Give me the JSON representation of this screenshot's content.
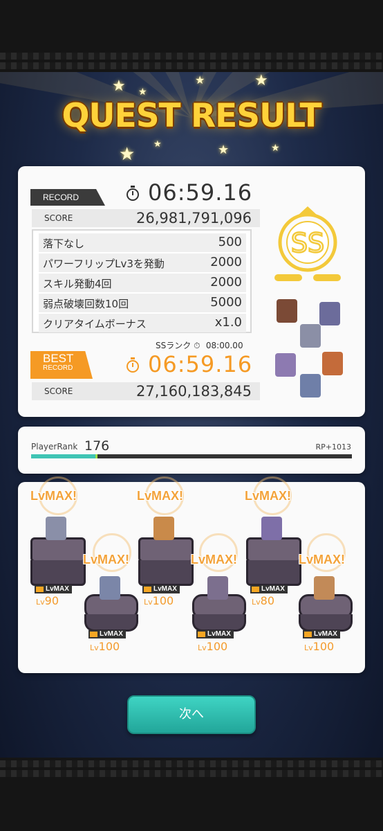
{
  "title": "QUEST RESULT",
  "record": {
    "tag": "RECORD",
    "time": "06:59.16",
    "score_label": "SCORE",
    "score": "26,981,791,096"
  },
  "bonuses": [
    {
      "name": "落下なし",
      "value": "500"
    },
    {
      "name": "パワーフリップLv3を発動",
      "value": "2000"
    },
    {
      "name": "スキル発動4回",
      "value": "2000"
    },
    {
      "name": "弱点破壊回数10回",
      "value": "5000"
    },
    {
      "name": "クリアタイムボーナス",
      "value": "x1.0"
    }
  ],
  "rank_grade": "SS",
  "ss_rank": {
    "label": "SSランク",
    "time": "08:00.00"
  },
  "best": {
    "tag_big": "BEST",
    "tag_small": "RECORD",
    "time": "06:59.16",
    "score_label": "SCORE",
    "score": "27,160,183,845"
  },
  "player": {
    "rank_label": "PlayerRank",
    "rank": "176",
    "rp": "RP+1013",
    "rp_progress": 0.2
  },
  "party": [
    {
      "lvmax": "LvMAX!",
      "badge": "LvMAX",
      "lv_prefix": "Lv",
      "lv": "90"
    },
    {
      "lvmax": "LvMAX!",
      "badge": "LvMAX",
      "lv_prefix": "Lv",
      "lv": "100"
    },
    {
      "lvmax": "LvMAX!",
      "badge": "LvMAX",
      "lv_prefix": "Lv",
      "lv": "100"
    },
    {
      "lvmax": "LvMAX!",
      "badge": "LvMAX",
      "lv_prefix": "Lv",
      "lv": "100"
    },
    {
      "lvmax": "LvMAX!",
      "badge": "LvMAX",
      "lv_prefix": "Lv",
      "lv": "80"
    },
    {
      "lvmax": "LvMAX!",
      "badge": "LvMAX",
      "lv_prefix": "Lv",
      "lv": "100"
    }
  ],
  "next_button": "次へ",
  "colors": {
    "accent": "#f59a24",
    "teal": "#3fc4b4",
    "gold": "#ffd23a"
  }
}
